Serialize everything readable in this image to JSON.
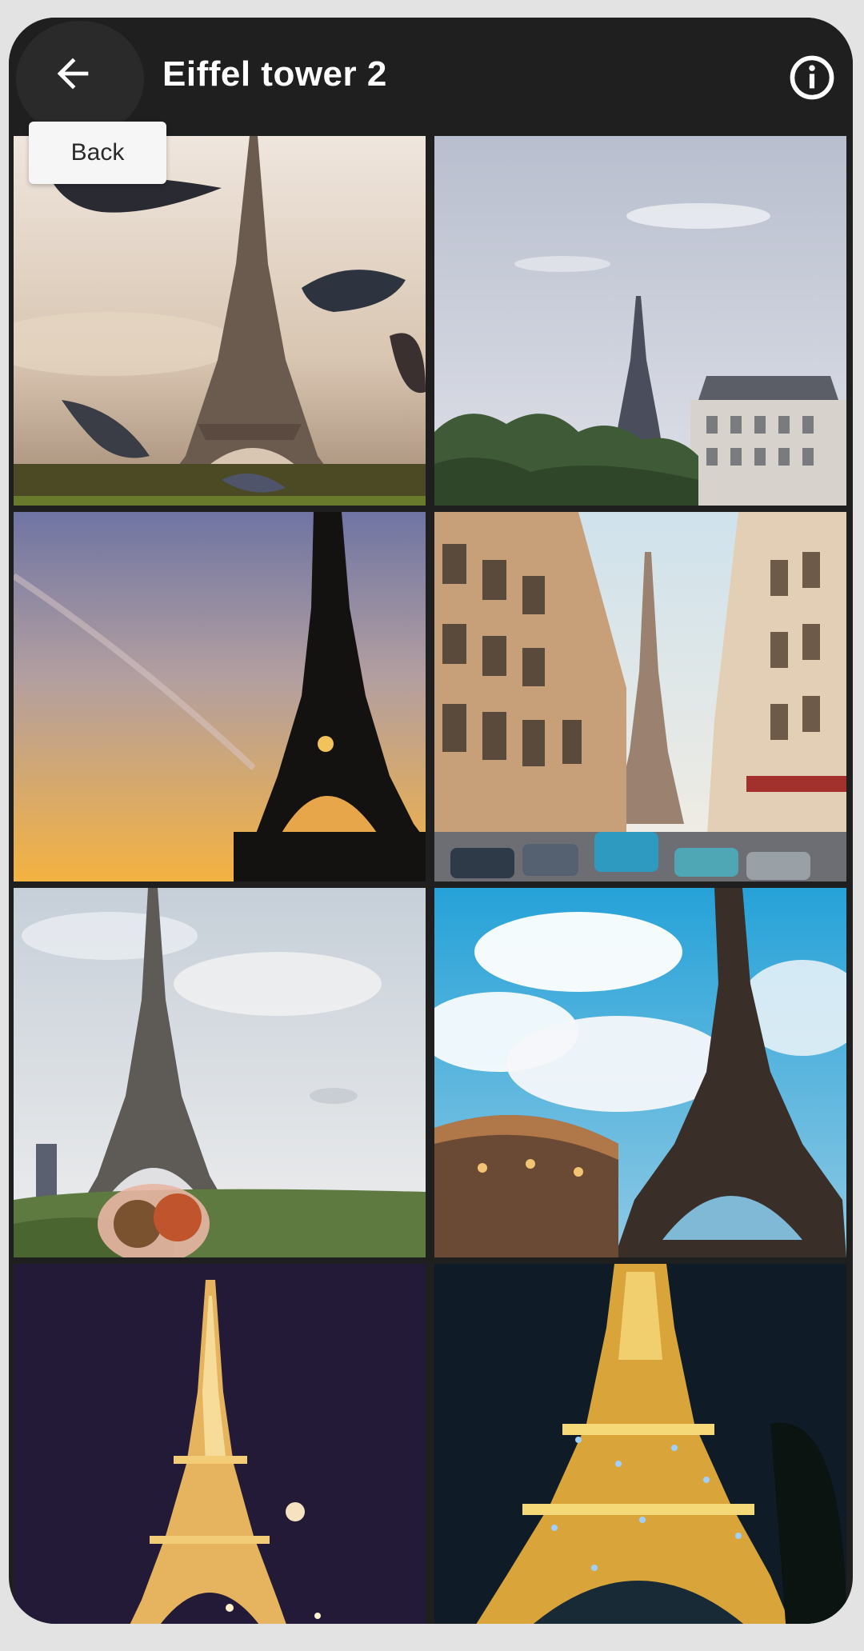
{
  "header": {
    "title": "Eiffel tower 2",
    "back_icon": "arrow-back-icon",
    "info_icon": "info-icon"
  },
  "tooltip": {
    "text": "Back"
  },
  "photos": [
    {
      "scene": "pigeons-flying",
      "sky_top": "#ece4dc",
      "sky_bottom": "#b8a28e",
      "tower_color": "#6b5a4e"
    },
    {
      "scene": "distant-cloudy",
      "sky_top": "#b9bfcf",
      "sky_bottom": "#d8dbe4",
      "tower_color": "#4a4e5c"
    },
    {
      "scene": "sunset-silhouette",
      "sky_top": "#7a7ea6",
      "sky_bottom": "#f0b24a",
      "tower_color": "#141210"
    },
    {
      "scene": "street-view",
      "sky_top": "#d8e6ec",
      "sky_bottom": "#f2ece0",
      "tower_color": "#9a8170"
    },
    {
      "scene": "cloudy-day-couple",
      "sky_top": "#c7d0d9",
      "sky_bottom": "#ecedee",
      "tower_color": "#5e5b56"
    },
    {
      "scene": "blue-sky-carousel",
      "sky_top": "#2aa3d6",
      "sky_bottom": "#ffffff",
      "tower_color": "#3a2e28"
    },
    {
      "scene": "night-lights-purple",
      "sky_top": "#221a36",
      "sky_bottom": "#2b2240",
      "tower_color": "#f1c774"
    },
    {
      "scene": "night-lights-navy",
      "sky_top": "#0d1a26",
      "sky_bottom": "#142330",
      "tower_color": "#e5b040"
    }
  ]
}
